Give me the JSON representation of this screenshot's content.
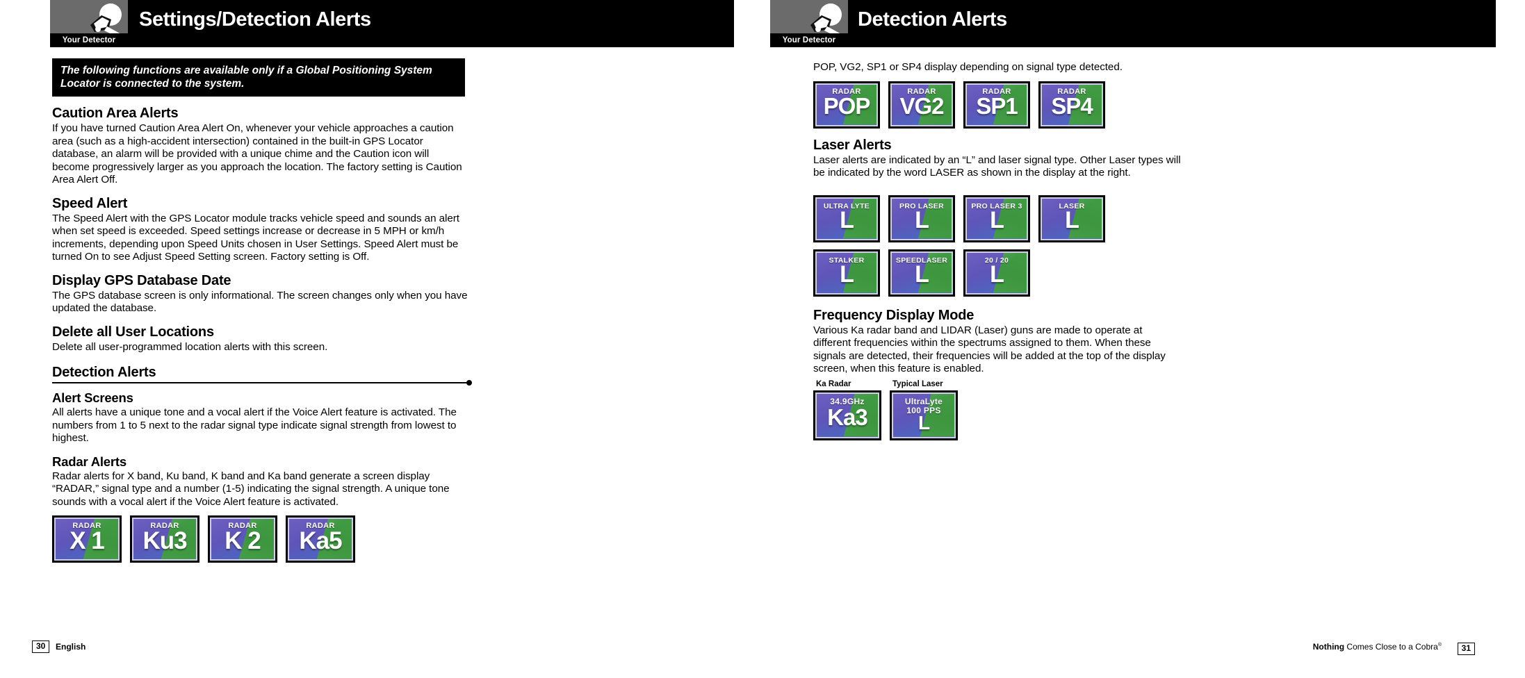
{
  "left_page": {
    "header": {
      "thumb_label": "Your Detector",
      "title": "Settings/Detection Alerts",
      "thumb_icon": "radar-detector-icon"
    },
    "callout": "The following functions are available only if a Global Positioning System Locator is connected to the system.",
    "sections": [
      {
        "heading": "Caution Area Alerts",
        "body": "If you have turned Caution Area Alert On, whenever your vehicle approaches a caution area (such as a high-accident intersection) contained in the built-in GPS Locator database, an alarm will be provided with a unique chime and the Caution icon will become progressively larger as you approach the location. The factory setting is Caution Area Alert Off."
      },
      {
        "heading": "Speed Alert",
        "body": "The Speed Alert with the GPS Locator module tracks vehicle speed and sounds an alert when set speed is exceeded. Speed settings increase or decrease in 5 MPH or km/h increments, depending upon Speed Units chosen in User Settings. Speed Alert must be turned On to see Adjust Speed Setting screen. Factory setting is Off."
      },
      {
        "heading": "Display GPS Database Date",
        "body": "The GPS database screen is only informational. The screen changes only when you have updated the database."
      },
      {
        "heading": "Delete all User Locations",
        "body": "Delete all user-programmed location alerts with this screen."
      }
    ],
    "rule_heading": "Detection Alerts",
    "alert_screens": {
      "heading": "Alert Screens",
      "body": "All alerts have a unique tone and a vocal alert if the Voice Alert feature is activated. The numbers from 1 to 5 next to the radar signal type indicate signal strength from lowest to highest."
    },
    "radar_alerts": {
      "heading": "Radar Alerts",
      "body": "Radar alerts for X band, Ku band, K band and Ka band generate a screen display “RADAR,” signal type and a number (1-5) indicating the signal strength. A unique tone sounds with a vocal alert if the Voice Alert feature is activated."
    },
    "radar_tiles": [
      {
        "label": "RADAR",
        "value": "X 1"
      },
      {
        "label": "RADAR",
        "value": "Ku3"
      },
      {
        "label": "RADAR",
        "value": "K 2"
      },
      {
        "label": "RADAR",
        "value": "Ka5"
      }
    ],
    "footer": {
      "page_number": "30",
      "text": "English"
    }
  },
  "right_page": {
    "header": {
      "thumb_label": "Your Detector",
      "title": "Detection Alerts",
      "thumb_icon": "radar-detector-icon"
    },
    "pop_intro": "POP, VG2, SP1 or SP4 display depending on signal type detected.",
    "pop_tiles": [
      {
        "label": "RADAR",
        "value": "POP"
      },
      {
        "label": "RADAR",
        "value": "VG2"
      },
      {
        "label": "RADAR",
        "value": "SP1"
      },
      {
        "label": "RADAR",
        "value": "SP4"
      }
    ],
    "laser_alerts": {
      "heading": "Laser Alerts",
      "body": "Laser alerts are indicated by an “L” and laser signal type. Other Laser types will be indicated by the word LASER as shown in the display at the right."
    },
    "laser_tiles_row1": [
      {
        "label": "ULTRA LYTE",
        "value": "L"
      },
      {
        "label": "PRO LASER",
        "value": "L"
      },
      {
        "label": "PRO LASER 3",
        "value": "L"
      },
      {
        "label": "LASER",
        "value": "L"
      }
    ],
    "laser_tiles_row2": [
      {
        "label": "STALKER",
        "value": "L"
      },
      {
        "label": "SPEEDLASER",
        "value": "L"
      },
      {
        "label": "20 / 20",
        "value": "L"
      }
    ],
    "frequency": {
      "heading": "Frequency Display Mode",
      "body": "Various Ka radar band and LIDAR (Laser) guns are made to operate at different frequencies within the spectrums assigned to them. When these signals are detected, their frequencies will be added at the top of the display screen, when this feature is enabled."
    },
    "freq_tiles": [
      {
        "caption": "Ka Radar",
        "label": "34.9GHz",
        "value": "Ka3"
      },
      {
        "caption": "Typical Laser",
        "label": "UltraLyte\n100 PPS",
        "value": "L"
      }
    ],
    "footer": {
      "page_number": "31",
      "tagline_bold": "Nothing",
      "tagline_rest": " Comes Close to a Cobra",
      "tagline_sup": "®"
    }
  }
}
